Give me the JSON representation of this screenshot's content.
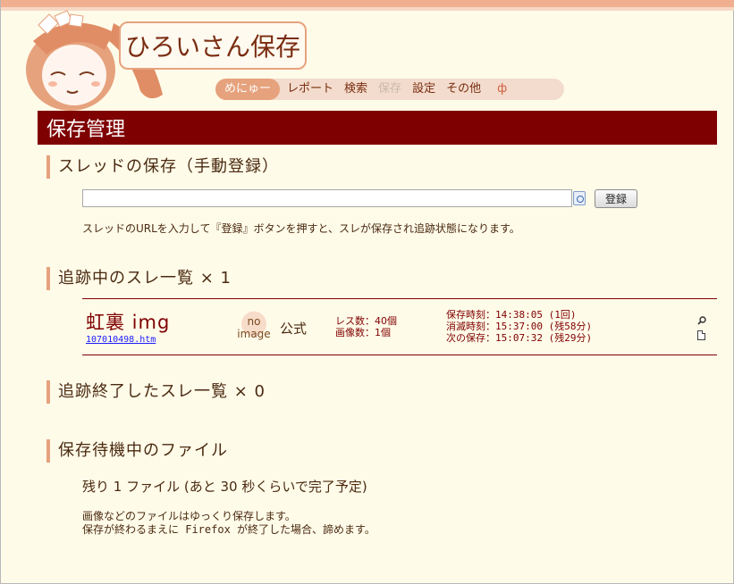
{
  "logo": {
    "title": "ひろいさん保存"
  },
  "menu": {
    "items": [
      {
        "label": "めにゅー",
        "state": "active"
      },
      {
        "label": "レポート",
        "state": "normal"
      },
      {
        "label": "検索",
        "state": "normal"
      },
      {
        "label": "保存",
        "state": "disabled"
      },
      {
        "label": "設定",
        "state": "normal"
      },
      {
        "label": "その他",
        "state": "normal"
      },
      {
        "label": "ф",
        "state": "normal"
      }
    ]
  },
  "page": {
    "title": "保存管理"
  },
  "manual_save": {
    "heading": "スレッドの保存（手動登録）",
    "url_value": "",
    "button_label": "登録",
    "hint": "スレッドのURLを入力して『登録』ボタンを押すと、スレが保存され追跡状態になります。"
  },
  "tracking": {
    "heading": "追跡中のスレ一覧 × 1",
    "thread": {
      "title": "虹裏 img",
      "link": "107010498.htm",
      "no_image_line1": "no",
      "no_image_line2": "image",
      "kind": "公式",
      "res_count": "レス数：40個",
      "image_count": "画像数：1個",
      "saved_time": "保存時刻：14:38:05 (1回)",
      "expire_time": "消滅時刻：15:37:00 (残58分)",
      "next_save": "次の保存：15:07:32 (残29分)"
    }
  },
  "finished": {
    "heading": "追跡終了したスレ一覧 × 0"
  },
  "pending": {
    "heading": "保存待機中のファイル",
    "remaining": "残り 1 ファイル (あと 30 秒くらいで完了予定)",
    "note_line1": "画像などのファイルはゆっくり保存します。",
    "note_line2": "保存が終わるまえに Firefox が終了した場合、諦めます。"
  },
  "colors": {
    "accent": "#e6a27d",
    "title_bar": "#7f0000",
    "background": "#fffbe9"
  },
  "icons": {
    "paste": "paste-icon",
    "zoom": "zoom-icon",
    "document": "document-icon",
    "mascot": "mascot-illustration"
  }
}
